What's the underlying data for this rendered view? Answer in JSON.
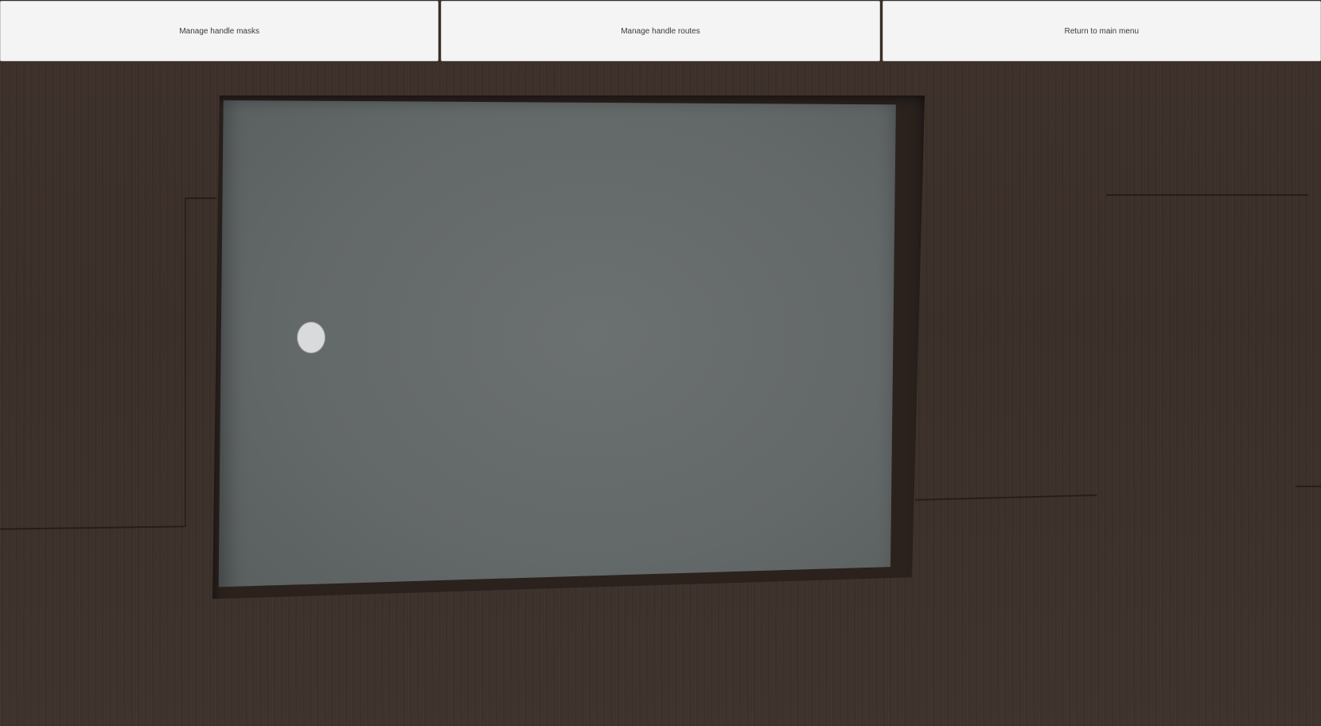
{
  "toolbar": {
    "buttons": [
      {
        "label": "Manage handle masks"
      },
      {
        "label": "Manage handle routes"
      },
      {
        "label": "Return to main menu"
      }
    ]
  },
  "scene": {
    "background_color": "#3b2f29",
    "mirror_color": "#636868",
    "handle_color": "#d8dadb"
  }
}
